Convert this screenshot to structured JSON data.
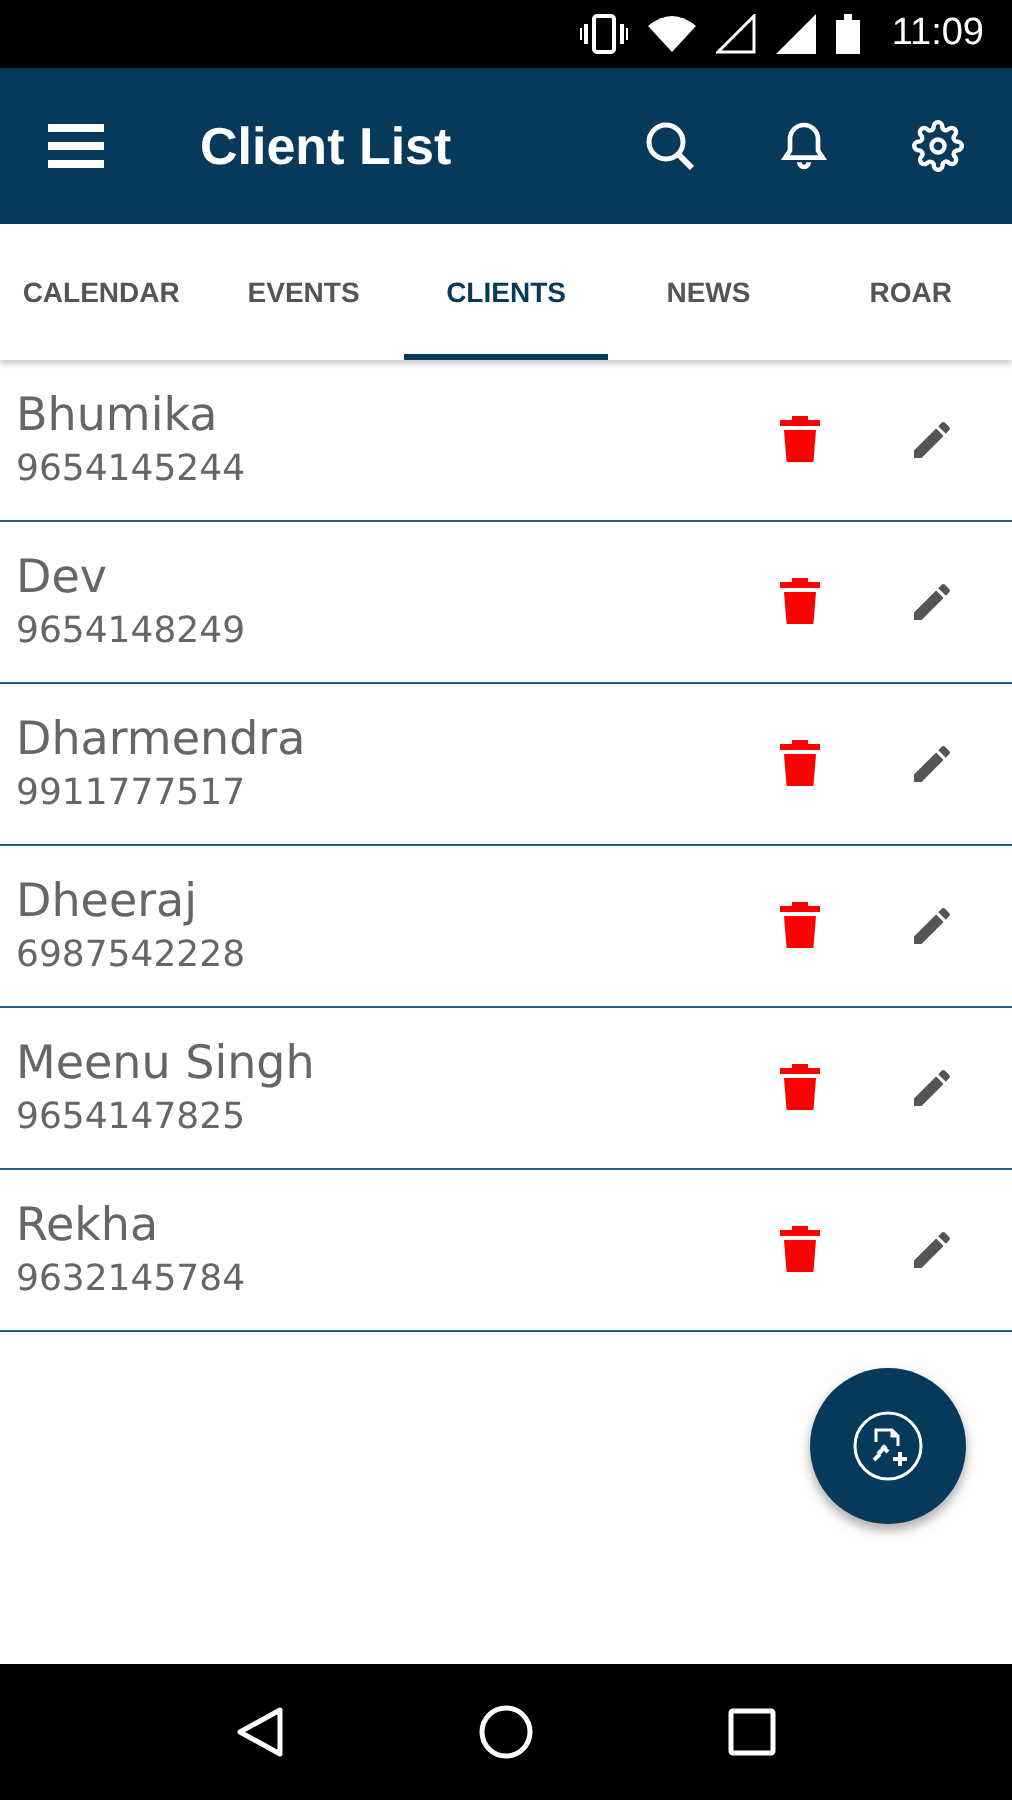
{
  "status_bar": {
    "time": "11:09"
  },
  "app_bar": {
    "title": "Client List"
  },
  "tabs": [
    {
      "label": "CALENDAR",
      "selected": false
    },
    {
      "label": "EVENTS",
      "selected": false
    },
    {
      "label": "CLIENTS",
      "selected": true
    },
    {
      "label": "NEWS",
      "selected": false
    },
    {
      "label": "ROAR",
      "selected": false
    }
  ],
  "clients": [
    {
      "name": "Bhumika",
      "phone": "9654145244"
    },
    {
      "name": "Dev",
      "phone": "9654148249"
    },
    {
      "name": "Dharmendra",
      "phone": "9911777517"
    },
    {
      "name": "Dheeraj",
      "phone": "6987542228"
    },
    {
      "name": "Meenu Singh",
      "phone": "9654147825"
    },
    {
      "name": "Rekha",
      "phone": "9632145784"
    }
  ]
}
